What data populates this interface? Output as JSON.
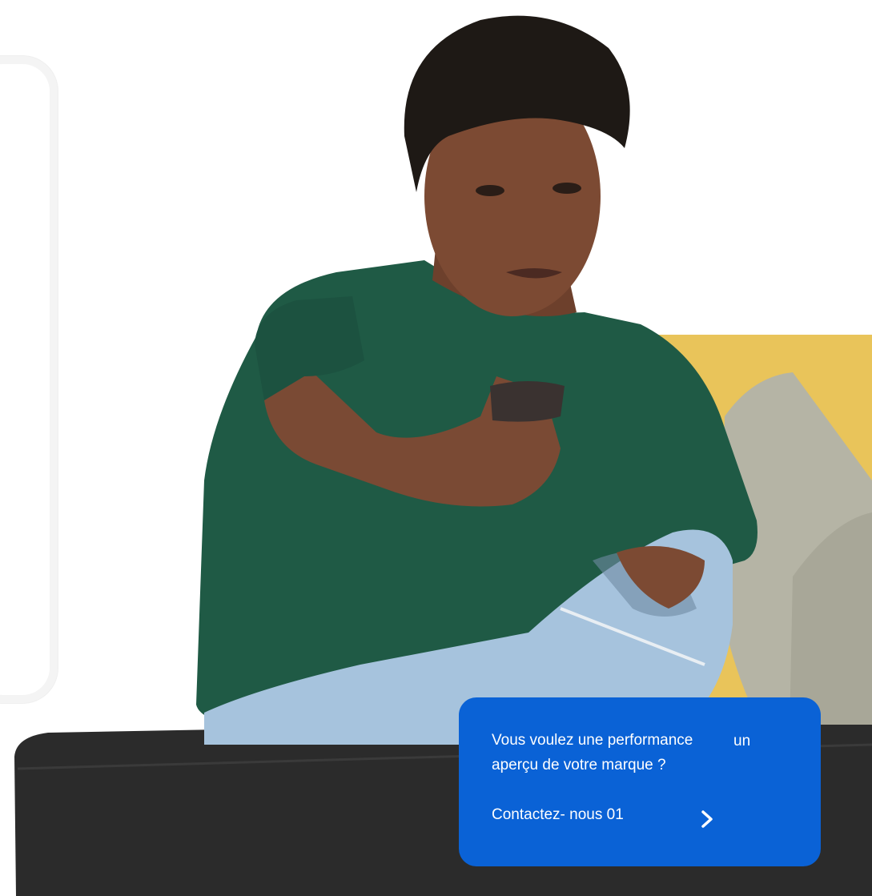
{
  "promo": {
    "line1": "Vous voulez une performance",
    "line1_extra": "un",
    "line2": "aperçu de votre marque ?",
    "cta_label": "Contactez- nous 01",
    "arrow_icon": "chevron-right-icon"
  },
  "colors": {
    "promo_background": "#0a62d6",
    "promo_text": "#ffffff"
  }
}
